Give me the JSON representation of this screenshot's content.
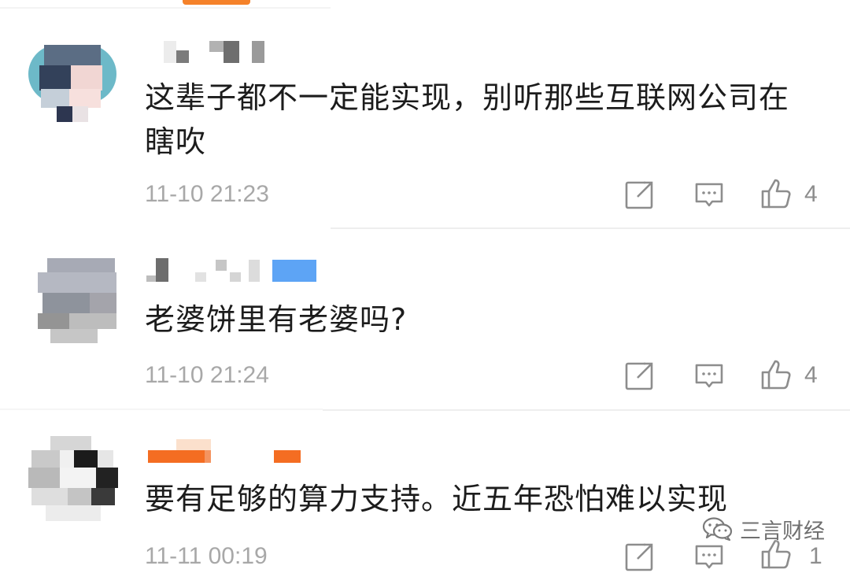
{
  "comments": [
    {
      "text": "这辈子都不一定能实现，别听那些互联网公司在瞎吹",
      "time": "11-10 21:23",
      "likes": "4"
    },
    {
      "text": "老婆饼里有老婆吗?",
      "time": "11-10 21:24",
      "likes": "4"
    },
    {
      "text": "要有足够的算力支持。近五年恐怕难以实现",
      "time": "11-11 00:19",
      "likes": "1"
    }
  ],
  "icons": {
    "forward": "share-icon",
    "reply": "comment-icon",
    "like": "thumbs-up-icon",
    "watermark": "wechat-icon"
  },
  "watermark": "三言财经",
  "colors": {
    "accent": "#f5822a",
    "text": "#1c1c1c",
    "meta": "#a8a8a8",
    "icon": "#8d8d8d",
    "highlight_blue": "#5da4f5"
  }
}
